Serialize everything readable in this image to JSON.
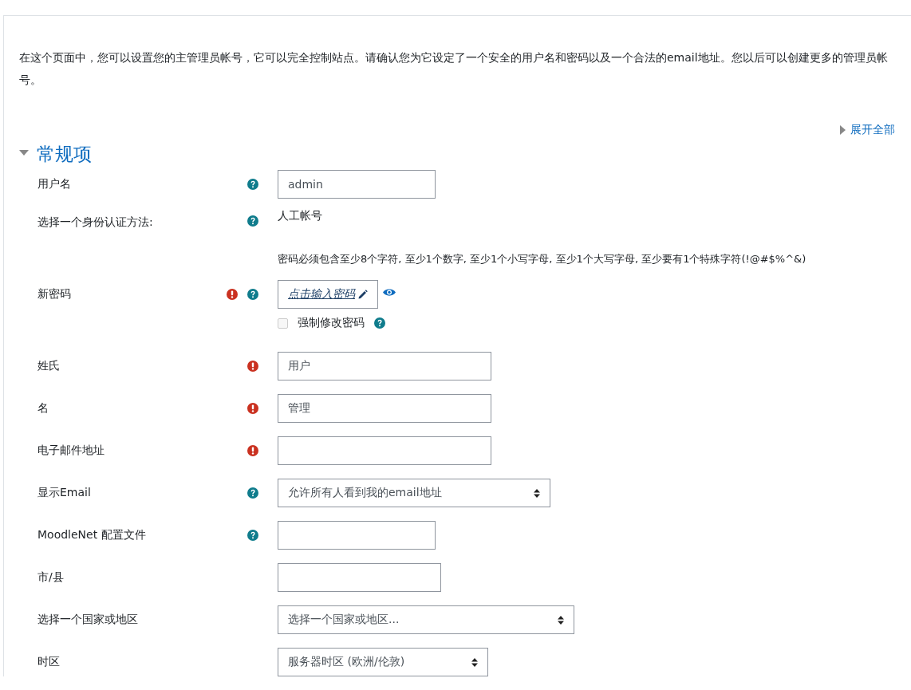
{
  "intro": "在这个页面中，您可以设置您的主管理员帐号，它可以完全控制站点。请确认您为它设定了一个安全的用户名和密码以及一个合法的email地址。您以后可以创建更多的管理员帐号。",
  "expand_all": "展开全部",
  "section": {
    "title": "常规项",
    "expanded": true
  },
  "fields": [
    {
      "kind": "text",
      "label": "用户名",
      "required": false,
      "help": true,
      "value": "admin"
    },
    {
      "kind": "static",
      "label": "选择一个身份认证方法:",
      "required": false,
      "help": true,
      "value": "人工帐号"
    },
    {
      "kind": "password",
      "label": "新密码",
      "required": true,
      "help": true,
      "hint": "密码必须包含至少8个字符, 至少1个数字, 至少1个小写字母, 至少1个大写字母, 至少要有1个特殊字符(!@#$%^&)",
      "value": "点击输入密码",
      "checkbox": {
        "label": "强制修改密码",
        "checked": false,
        "help": true
      }
    },
    {
      "kind": "text",
      "label": "姓氏",
      "required": true,
      "help": false,
      "value": "用户"
    },
    {
      "kind": "text",
      "label": "名",
      "required": true,
      "help": false,
      "value": "管理"
    },
    {
      "kind": "text",
      "label": "电子邮件地址",
      "required": true,
      "help": false
    },
    {
      "kind": "select",
      "label": "显示Email",
      "required": false,
      "help": true,
      "value": "允许所有人看到我的email地址"
    },
    {
      "kind": "text",
      "label": "MoodleNet 配置文件",
      "required": false,
      "help": true
    },
    {
      "kind": "text",
      "label": "市/县",
      "required": false,
      "help": false
    },
    {
      "kind": "select",
      "label": "选择一个国家或地区",
      "required": false,
      "help": false,
      "value": "选择一个国家或地区..."
    },
    {
      "kind": "select",
      "label": "时区",
      "required": false,
      "help": false,
      "value": "服务器时区 (欧洲/伦敦)"
    }
  ]
}
